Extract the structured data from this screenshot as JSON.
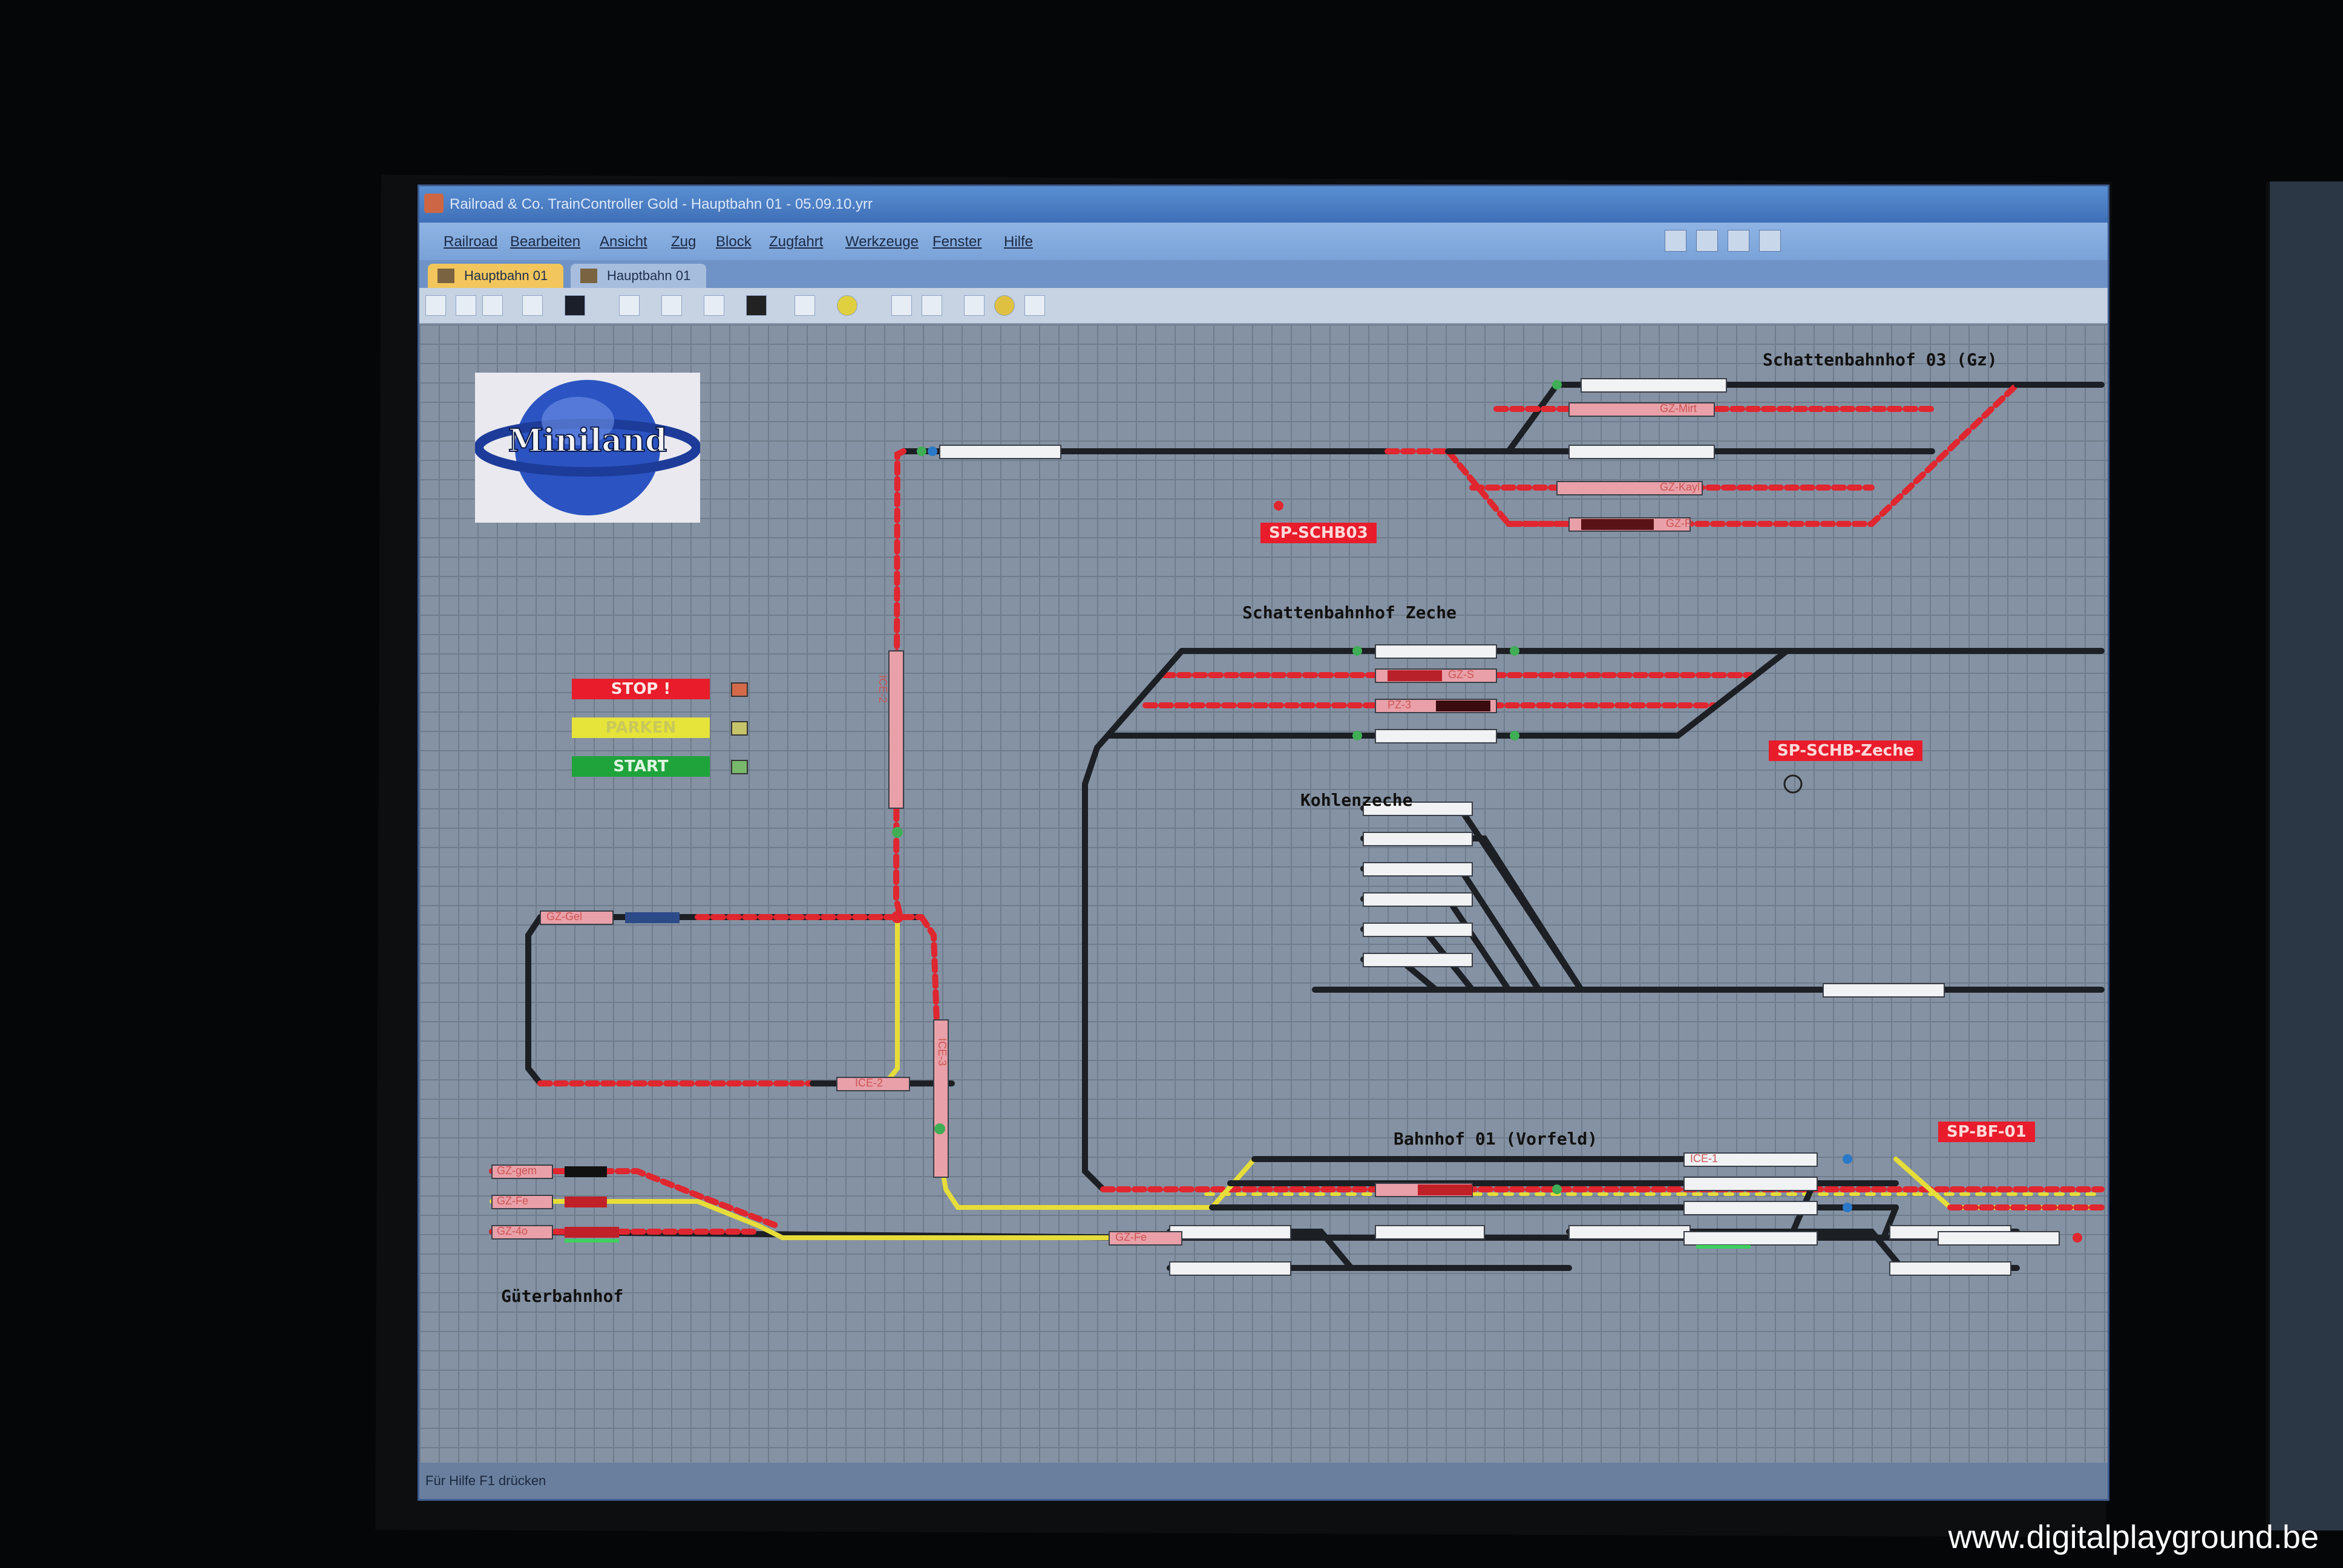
{
  "window": {
    "title": "Railroad & Co. TrainController Gold - Hauptbahn 01 - 05.09.10.yrr",
    "menu": [
      "Railroad",
      "Bearbeiten",
      "Ansicht",
      "Zug",
      "Block",
      "Zugfahrt",
      "Werkzeuge",
      "Fenster",
      "Hilfe"
    ],
    "tabs": [
      "Hauptbahn 01",
      "Hauptbahn 01"
    ],
    "status": "Für Hilfe F1 drücken"
  },
  "logo": {
    "text": "Miniland"
  },
  "controls": {
    "stop": "STOP !",
    "parken": "PARKEN",
    "start": "START",
    "colors": {
      "stop": "#e81c2a",
      "parken": "#e6e33a",
      "start": "#1fa43c"
    }
  },
  "stations": {
    "schattenbahnhof03": "Schattenbahnhof 03 (Gz)",
    "schattenbahnhof_zeche": "Schattenbahnhof Zeche",
    "kohlenzeche": "Kohlenzeche",
    "bahnhof01": "Bahnhof 01 (Vorfeld)",
    "gueterbahnhof": "Güterbahnhof"
  },
  "switch_panels": {
    "schb03": "SP-SCHB03",
    "schb_zeche": "SP-SCHB-Zeche",
    "bf01": "SP-BF-01"
  },
  "trains": {
    "gz_mirt": "GZ-Mirt",
    "gz_ka": "GZ-Kayl",
    "gz_r": "GZ-R",
    "gz_s": "GZ-S",
    "pz3": "PZ-3",
    "ice2_vertical": "ICE-2",
    "gz_gel": "GZ-Gel",
    "ice2_bottom": "ICE-2",
    "ice3": "ICE-3",
    "ice1": "ICE-1",
    "gz_gem": "GZ-gem",
    "gz_fe": "GZ-Fe",
    "gz_4o": "GZ-4o",
    "gz_fe2": "GZ-Fe"
  },
  "watermark": "www.digitalplayground.be",
  "colors": {
    "track": "#1c1f24",
    "occupied": "#e0262f",
    "reserved": "#e6dd3a",
    "block": "#f0f2f4"
  }
}
